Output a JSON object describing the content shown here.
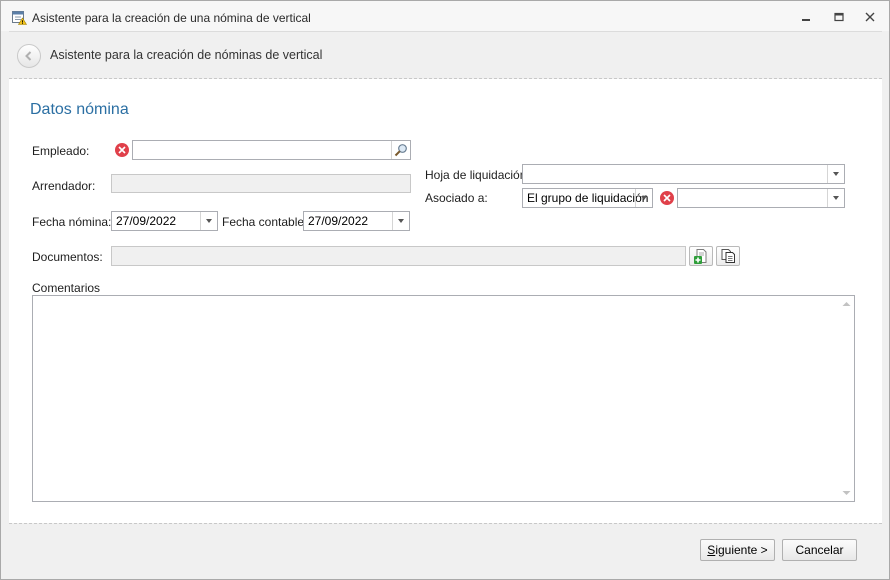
{
  "window": {
    "title": "Asistente para la creación de una nómina de vertical",
    "app_icon": "calendar-warning-icon",
    "controls": [
      "minimize-icon",
      "restore-icon",
      "close-icon"
    ]
  },
  "header": {
    "title": "Asistente para la creación de nóminas de vertical",
    "back_icon": "back-arrow-icon"
  },
  "section": {
    "title": "Datos nómina"
  },
  "form": {
    "empleado_label": "Empleado:",
    "empleado_value": "",
    "arrendador_label": "Arrendador:",
    "arrendador_value": "",
    "fecha_nomina_label": "Fecha nómina:",
    "fecha_nomina_value": "27/09/2022",
    "fecha_contable_label": "Fecha contable:",
    "fecha_contable_value": "27/09/2022",
    "hoja_label": "Hoja de liquidación:",
    "hoja_value": "",
    "asociado_label": "Asociado a:",
    "asociado_value": "El grupo de liquidación",
    "asociado_target_value": "",
    "documentos_label": "Documentos:",
    "documentos_value": "",
    "comentarios_label": "Comentarios",
    "comentarios_value": ""
  },
  "footer": {
    "next_label_underlined": "S",
    "next_label_rest": "iguiente >",
    "cancel_label": "Cancelar"
  },
  "colors": {
    "section_title": "#2b6fa3",
    "error_icon": "#e0404a",
    "window_bg": "#f0f0f0"
  }
}
